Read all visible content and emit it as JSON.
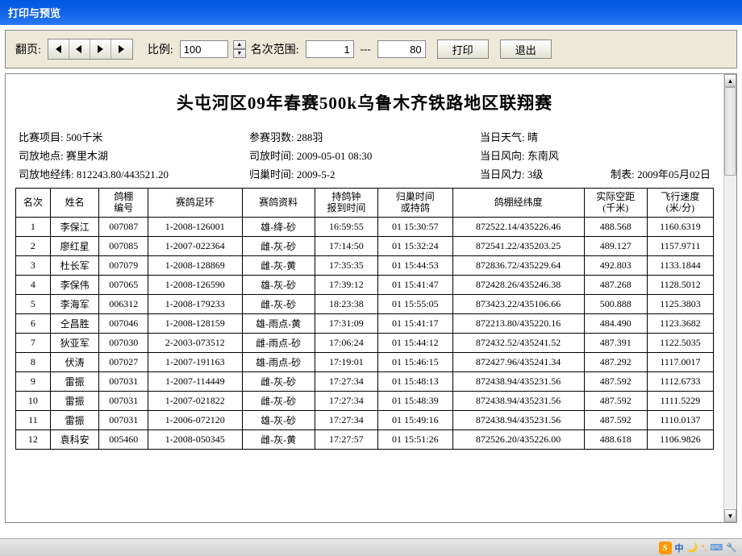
{
  "window": {
    "title": "打印与预览"
  },
  "toolbar": {
    "page_label": "翻页:",
    "ratio_label": "比例:",
    "ratio_value": "100",
    "range_label": "名次范围:",
    "range_from": "1",
    "range_sep": "---",
    "range_to": "80",
    "print_btn": "打印",
    "exit_btn": "退出"
  },
  "report": {
    "title": "头屯河区09年春赛500k乌鲁木齐铁路地区联翔赛",
    "meta": {
      "r1c1": "比赛项目:  500千米",
      "r1c2": "参赛羽数:  288羽",
      "r1c3": "当日天气:  晴",
      "r2c1": "司放地点:  赛里木湖",
      "r2c2": "司放时间:  2009-05-01   08:30",
      "r2c3": "当日风向:  东南风",
      "r3c1": "司放地经纬:  812243.80/443521.20",
      "r3c2": "归巢时间:  2009-5-2",
      "r3c3a": "当日风力:  3级",
      "r3c3b": "制表:  2009年05月02日"
    },
    "headers": [
      "名次",
      "姓名",
      "鸽棚编号",
      "赛鸽足环",
      "赛鸽资料",
      "持鸽钟报到时间",
      "归巢时间或持鸽",
      "鸽棚经纬度",
      "实际空距(千米)",
      "飞行速度(米/分)"
    ],
    "rows": [
      [
        "1",
        "李保江",
        "007087",
        "1-2008-126001",
        "雄-绛-砂",
        "16:59:55",
        "01 15:30:57",
        "872522.14/435226.46",
        "488.568",
        "1160.6319"
      ],
      [
        "2",
        "廖红星",
        "007085",
        "1-2007-022364",
        "雌-灰-砂",
        "17:14:50",
        "01 15:32:24",
        "872541.22/435203.25",
        "489.127",
        "1157.9711"
      ],
      [
        "3",
        "杜长军",
        "007079",
        "1-2008-128869",
        "雌-灰-黄",
        "17:35:35",
        "01 15:44:53",
        "872836.72/435229.64",
        "492.803",
        "1133.1844"
      ],
      [
        "4",
        "李保伟",
        "007065",
        "1-2008-126590",
        "雄-灰-砂",
        "17:39:12",
        "01 15:41:47",
        "872428.26/435246.38",
        "487.268",
        "1128.5012"
      ],
      [
        "5",
        "李海军",
        "006312",
        "1-2008-179233",
        "雌-灰-砂",
        "18:23:38",
        "01 15:55:05",
        "873423.22/435106.66",
        "500.888",
        "1125.3803"
      ],
      [
        "6",
        "仝昌胜",
        "007046",
        "1-2008-128159",
        "雄-雨点-黄",
        "17:31:09",
        "01 15:41:17",
        "872213.80/435220.16",
        "484.490",
        "1123.3682"
      ],
      [
        "7",
        "狄亚军",
        "007030",
        "2-2003-073512",
        "雌-雨点-砂",
        "17:06:24",
        "01 15:44:12",
        "872432.52/435241.52",
        "487.391",
        "1122.5035"
      ],
      [
        "8",
        "伏涛",
        "007027",
        "1-2007-191163",
        "雄-雨点-砂",
        "17:19:01",
        "01 15:46:15",
        "872427.96/435241.34",
        "487.292",
        "1117.0017"
      ],
      [
        "9",
        "雷振",
        "007031",
        "1-2007-114449",
        "雌-灰-砂",
        "17:27:34",
        "01 15:48:13",
        "872438.94/435231.56",
        "487.592",
        "1112.6733"
      ],
      [
        "10",
        "雷振",
        "007031",
        "1-2007-021822",
        "雌-灰-砂",
        "17:27:34",
        "01 15:48:39",
        "872438.94/435231.56",
        "487.592",
        "1111.5229"
      ],
      [
        "11",
        "雷振",
        "007031",
        "1-2006-072120",
        "雄-灰-砂",
        "17:27:34",
        "01 15:49:16",
        "872438.94/435231.56",
        "487.592",
        "1110.0137"
      ],
      [
        "12",
        "袁科安",
        "005460",
        "1-2008-050345",
        "雌-灰-黄",
        "17:27:57",
        "01 15:51:26",
        "872526.20/435226.00",
        "488.618",
        "1106.9826"
      ]
    ]
  },
  "tray": {
    "text": "中"
  }
}
